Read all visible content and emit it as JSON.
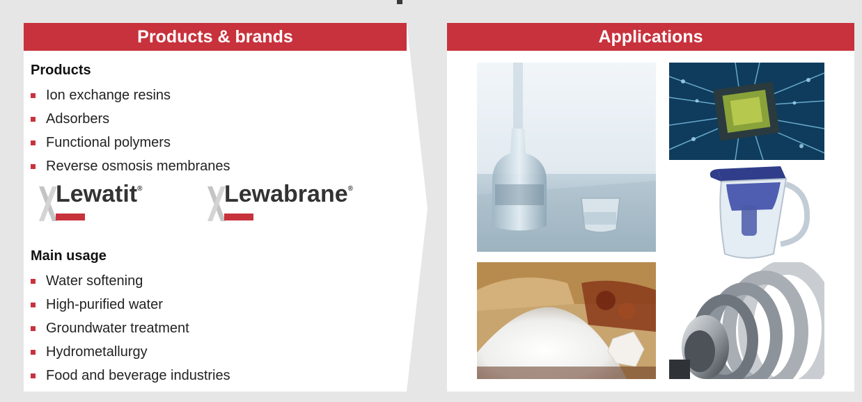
{
  "colors": {
    "accent": "#c8323c",
    "background": "#e6e6e6",
    "panel": "#ffffff"
  },
  "left_panel": {
    "header": "Products & brands",
    "products_title": "Products",
    "products": [
      "Ion exchange resins",
      "Adsorbers",
      "Functional polymers",
      "Reverse osmosis membranes"
    ],
    "brands": [
      {
        "name": "Lewatit",
        "mark": "®"
      },
      {
        "name": "Lewabrane",
        "mark": "®"
      }
    ],
    "usage_title": "Main usage",
    "usage": [
      "Water softening",
      "High-purified water",
      "Groundwater treatment",
      "Hydrometallurgy",
      "Food and beverage industries"
    ]
  },
  "right_panel": {
    "header": "Applications",
    "images": [
      "glass-bottle-photo",
      "microchip-photo",
      "water-filter-pitcher-photo",
      "sugar-photo",
      "turbine-photo"
    ]
  }
}
